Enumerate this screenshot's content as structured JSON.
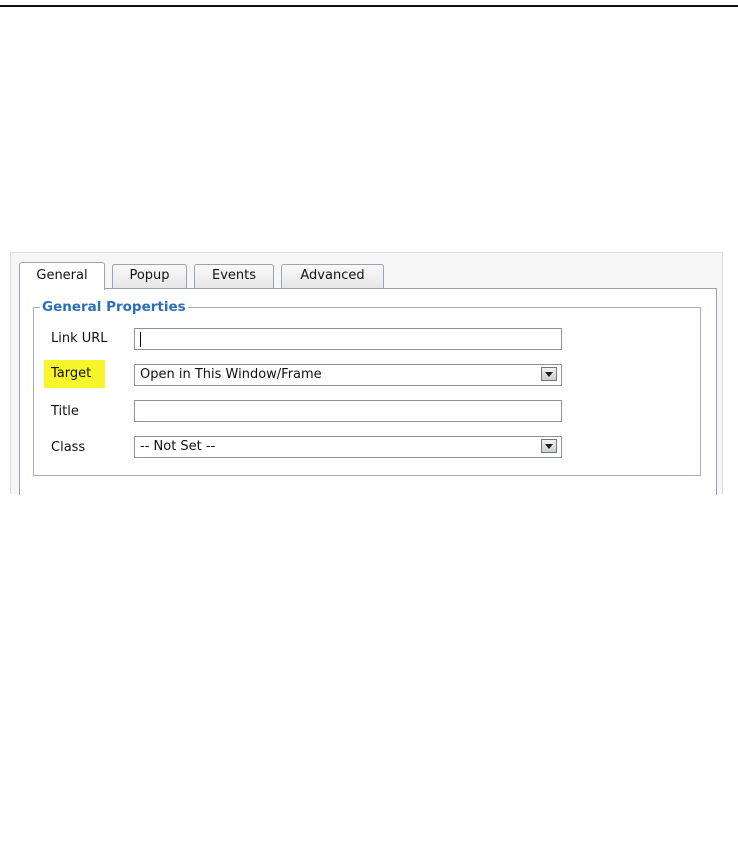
{
  "tabs": [
    "General",
    "Popup",
    "Events",
    "Advanced"
  ],
  "active_tab": "General",
  "legend": "General Properties",
  "fields": {
    "link_url": {
      "label": "Link URL",
      "value": ""
    },
    "target": {
      "label": "Target",
      "value": "Open in This Window/Frame",
      "highlighted": true
    },
    "title": {
      "label": "Title",
      "value": ""
    },
    "class": {
      "label": "Class",
      "value": "-- Not Set --"
    }
  },
  "colors": {
    "highlight": "#f7f62a",
    "legend": "#2a6fb8",
    "arrow": "#2b4a7c"
  },
  "annotation": {
    "icon": "left-arrow-icon"
  }
}
